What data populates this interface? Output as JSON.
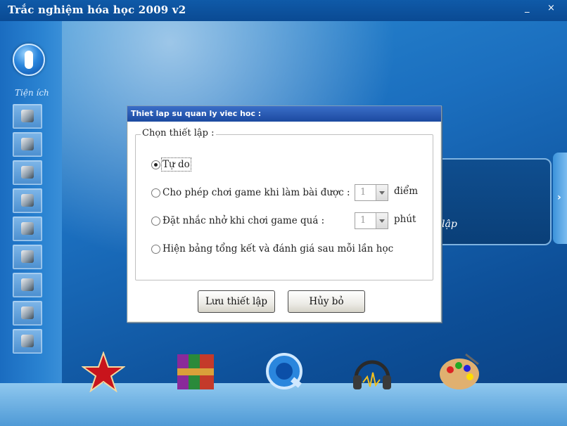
{
  "window": {
    "title": "Trắc nghiệm hóa học 2009  v2",
    "minimize": "_",
    "close": "×"
  },
  "sidebar": {
    "heading": "Tiện ích",
    "tools": [
      {
        "icon": "usb-drive-icon"
      },
      {
        "icon": "chip-icon"
      },
      {
        "icon": "molecule-icon"
      },
      {
        "icon": "monitor-icon"
      },
      {
        "icon": "table-icon"
      },
      {
        "icon": "books-icon"
      },
      {
        "icon": "atom-icon"
      },
      {
        "icon": "edit-icon"
      },
      {
        "icon": "disk-icon"
      }
    ]
  },
  "background_panel": {
    "partial_text": "lập"
  },
  "right_toggle": "›",
  "dock": [
    {
      "icon": "star-icon"
    },
    {
      "icon": "archive-icon"
    },
    {
      "icon": "quicktime-icon"
    },
    {
      "icon": "headphones-icon"
    },
    {
      "icon": "palette-icon"
    }
  ],
  "dialog": {
    "title": "Thiet lap su quan ly viec hoc :",
    "group_label": "Chọn thiết lập :",
    "options": [
      {
        "label": "Tự do",
        "selected": true
      },
      {
        "label": "Cho phép chơi game khi làm bài được :",
        "selected": false,
        "value": "1",
        "unit": "điểm"
      },
      {
        "label": "Đặt nhắc nhở khi chơi game quá :",
        "selected": false,
        "value": "1",
        "unit": "phút"
      },
      {
        "label": "Hiện bảng tổng kết và đánh giá sau mỗi lần học",
        "selected": false
      }
    ],
    "save_label": "Lưu thiết lập",
    "cancel_label": "Hủy bỏ"
  },
  "colors": {
    "titlebar": "#0a4a93",
    "dialog_title": "#1c4aa0",
    "background": "#1b6fbf"
  }
}
